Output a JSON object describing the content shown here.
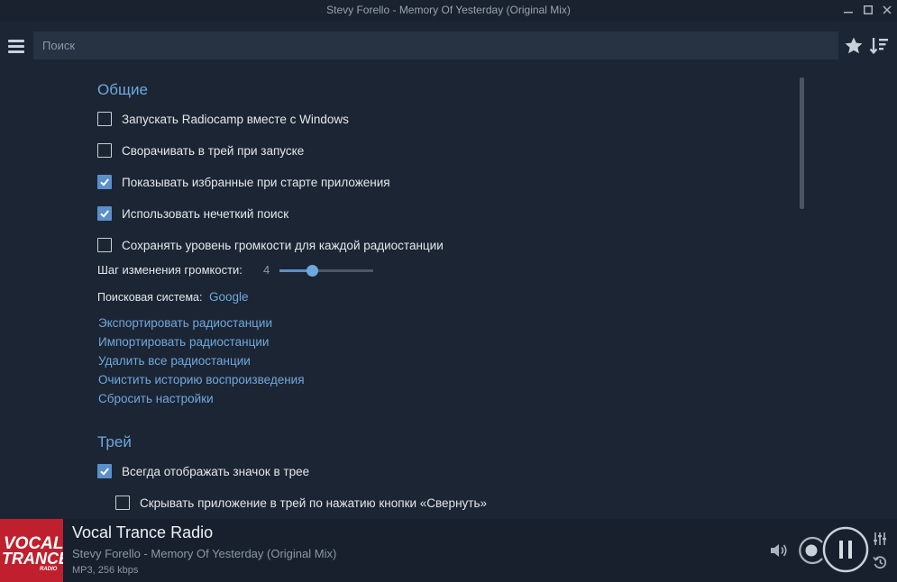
{
  "window": {
    "title": "Stevy Forello - Memory Of Yesterday (Original Mix)"
  },
  "toolbar": {
    "search_placeholder": "Поиск"
  },
  "general": {
    "title": "Общие",
    "checkboxes": [
      {
        "label": "Запускать Radiocamp вместе с Windows",
        "checked": false
      },
      {
        "label": "Сворачивать в трей при запуске",
        "checked": false
      },
      {
        "label": "Показывать избранные при старте приложения",
        "checked": true
      },
      {
        "label": "Использовать нечеткий поиск",
        "checked": true
      },
      {
        "label": "Сохранять уровень громкости для каждой радиостанции",
        "checked": false
      }
    ],
    "volume_step_label": "Шаг изменения громкости:",
    "volume_step_value": "4",
    "volume_step_fill": 0.35,
    "search_engine_label": "Поисковая система:",
    "search_engine_value": "Google",
    "links": [
      "Экспортировать радиостанции",
      "Импортировать радиостанции",
      "Удалить все радиостанции",
      "Очистить историю воспроизведения",
      "Сбросить настройки"
    ]
  },
  "tray": {
    "title": "Трей",
    "checkboxes": [
      {
        "label": "Всегда отображать значок в трее",
        "checked": true
      },
      {
        "label": "Скрывать приложение в трей по нажатию кнопки «Свернуть»",
        "checked": false
      }
    ]
  },
  "player": {
    "logo_text_line1": "VOCAL",
    "logo_text_line2": "TRANCE",
    "logo_text_line3": "RADIO",
    "station": "Vocal Trance Radio",
    "track": "Stevy Forello - Memory Of Yesterday (Original Mix)",
    "format": "MP3, 256 kbps"
  },
  "colors": {
    "background": "#1c2533",
    "accent": "#6fa8de",
    "checkbox_checked": "#5b8fc9",
    "logo_red": "#c0202e"
  },
  "icons": [
    "menu-icon",
    "star-icon",
    "sort-icon",
    "volume-icon",
    "record-icon",
    "pause-icon",
    "equalizer-icon",
    "history-icon"
  ]
}
